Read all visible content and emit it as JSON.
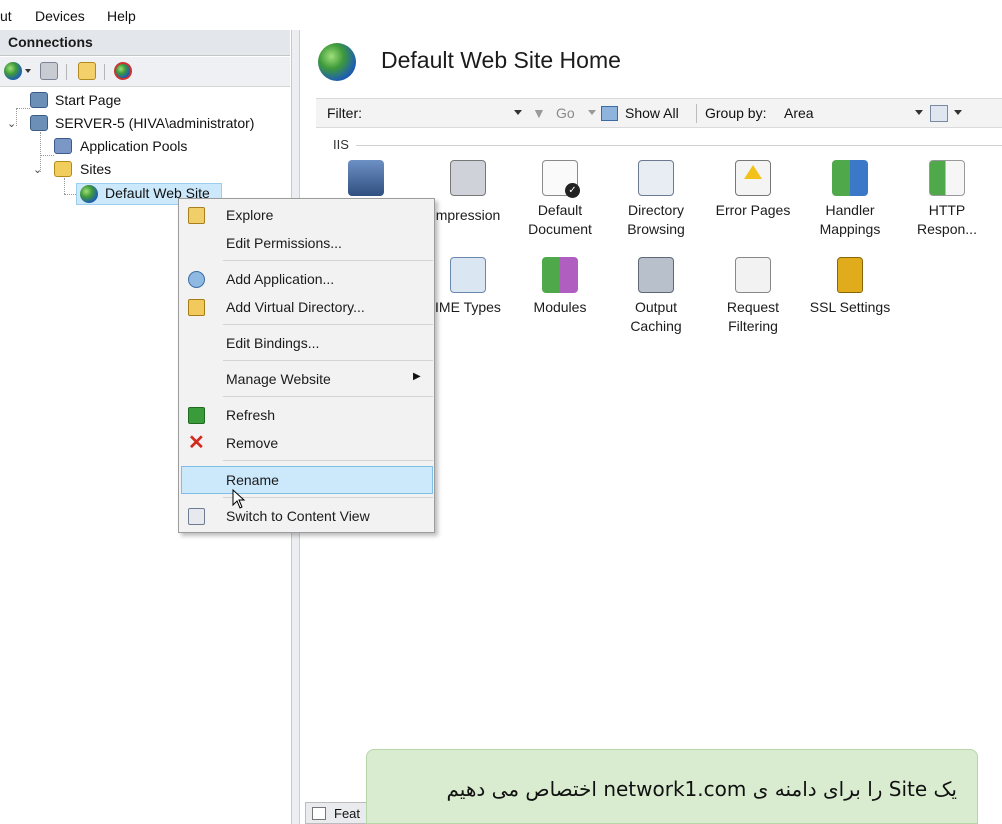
{
  "menubar": {
    "items": [
      "ut",
      "Devices",
      "Help"
    ]
  },
  "connections": {
    "header": "Connections",
    "toolbar_icons": [
      "connect-icon",
      "save-icon",
      "up-folder-icon",
      "disconnect-icon"
    ],
    "tree": {
      "start_page": "Start Page",
      "server": "SERVER-5 (HIVA\\administrator)",
      "app_pools": "Application Pools",
      "sites": "Sites",
      "default_site": "Default Web Site"
    }
  },
  "main": {
    "title": "Default Web Site Home",
    "filter": {
      "filter_label": "Filter:",
      "go_label": "Go",
      "show_all_label": "Show All",
      "group_by_label": "Group by:",
      "group_by_value": "Area"
    },
    "section_label": "IIS",
    "features_row1": [
      {
        "label": "",
        "icon": "authentication-icon"
      },
      {
        "label": "mpression",
        "icon": "compression-icon"
      },
      {
        "label": "Default\nDocument",
        "icon": "default-document-icon"
      },
      {
        "label": "Directory\nBrowsing",
        "icon": "directory-browsing-icon"
      },
      {
        "label": "Error Pages",
        "icon": "error-pages-icon"
      },
      {
        "label": "Handler\nMappings",
        "icon": "handler-mappings-icon"
      },
      {
        "label": "HTTP\nRespon...",
        "icon": "http-response-icon"
      }
    ],
    "features_row2": [
      {
        "label": "IME Types",
        "icon": "mime-types-icon"
      },
      {
        "label": "Modules",
        "icon": "modules-icon"
      },
      {
        "label": "Output\nCaching",
        "icon": "output-caching-icon"
      },
      {
        "label": "Request\nFiltering",
        "icon": "request-filtering-icon"
      },
      {
        "label": "SSL Settings",
        "icon": "ssl-settings-icon"
      }
    ],
    "bottom_tab": "Feat"
  },
  "context_menu": {
    "explore": "Explore",
    "edit_permissions": "Edit Permissions...",
    "add_application": "Add Application...",
    "add_virtual_directory": "Add Virtual Directory...",
    "edit_bindings": "Edit Bindings...",
    "manage_website": "Manage Website",
    "refresh": "Refresh",
    "remove": "Remove",
    "rename": "Rename",
    "switch_content_view": "Switch to Content View"
  },
  "subtitle": "یک Site را برای دامنه ی network1.com  اختصاص می دهیم",
  "colors": {
    "header_bg": "#e3e6ea",
    "highlight": "#cce8fb",
    "subtitle_bg": "#d9ecd0"
  }
}
